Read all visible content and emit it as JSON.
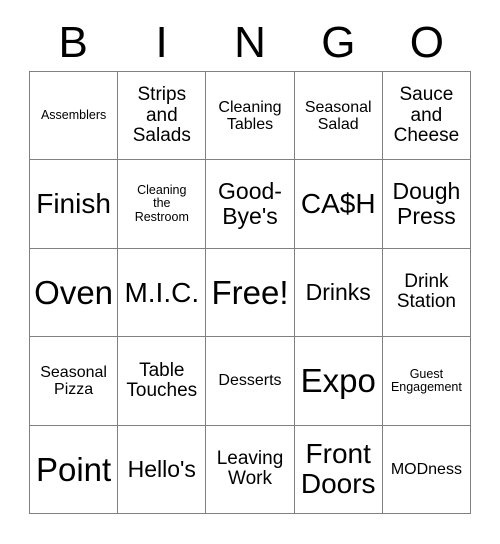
{
  "card": {
    "header": {
      "letters": [
        "B",
        "I",
        "N",
        "G",
        "O"
      ]
    },
    "cells": [
      {
        "text": "Assemblers",
        "size": "fs-xs",
        "free": false
      },
      {
        "text": "Strips\nand\nSalads",
        "size": "fs-m",
        "free": false
      },
      {
        "text": "Cleaning\nTables",
        "size": "fs-s",
        "free": false
      },
      {
        "text": "Seasonal\nSalad",
        "size": "fs-s",
        "free": false
      },
      {
        "text": "Sauce\nand\nCheese",
        "size": "fs-m",
        "free": false
      },
      {
        "text": "Finish",
        "size": "fs-xl",
        "free": false
      },
      {
        "text": "Cleaning\nthe\nRestroom",
        "size": "fs-xs",
        "free": false
      },
      {
        "text": "Good-\nBye's",
        "size": "fs-l",
        "free": false
      },
      {
        "text": "CA$H",
        "size": "fs-xl",
        "free": false
      },
      {
        "text": "Dough\nPress",
        "size": "fs-l",
        "free": false
      },
      {
        "text": "Oven",
        "size": "fs-xxl",
        "free": false
      },
      {
        "text": "M.I.C.",
        "size": "fs-xl",
        "free": false
      },
      {
        "text": "Free!",
        "size": "fs-xxl",
        "free": true
      },
      {
        "text": "Drinks",
        "size": "fs-l",
        "free": false
      },
      {
        "text": "Drink\nStation",
        "size": "fs-m",
        "free": false
      },
      {
        "text": "Seasonal\nPizza",
        "size": "fs-s",
        "free": false
      },
      {
        "text": "Table\nTouches",
        "size": "fs-m",
        "free": false
      },
      {
        "text": "Desserts",
        "size": "fs-s",
        "free": false
      },
      {
        "text": "Expo",
        "size": "fs-xxl",
        "free": false
      },
      {
        "text": "Guest\nEngagement",
        "size": "fs-xs",
        "free": false
      },
      {
        "text": "Point",
        "size": "fs-xxl",
        "free": false
      },
      {
        "text": "Hello's",
        "size": "fs-l",
        "free": false
      },
      {
        "text": "Leaving\nWork",
        "size": "fs-m",
        "free": false
      },
      {
        "text": "Front\nDoors",
        "size": "fs-xl",
        "free": false
      },
      {
        "text": "MODness",
        "size": "fs-s",
        "free": false
      }
    ],
    "colors": {
      "grid_line": "#808080",
      "text": "#000000",
      "background": "#ffffff"
    }
  }
}
